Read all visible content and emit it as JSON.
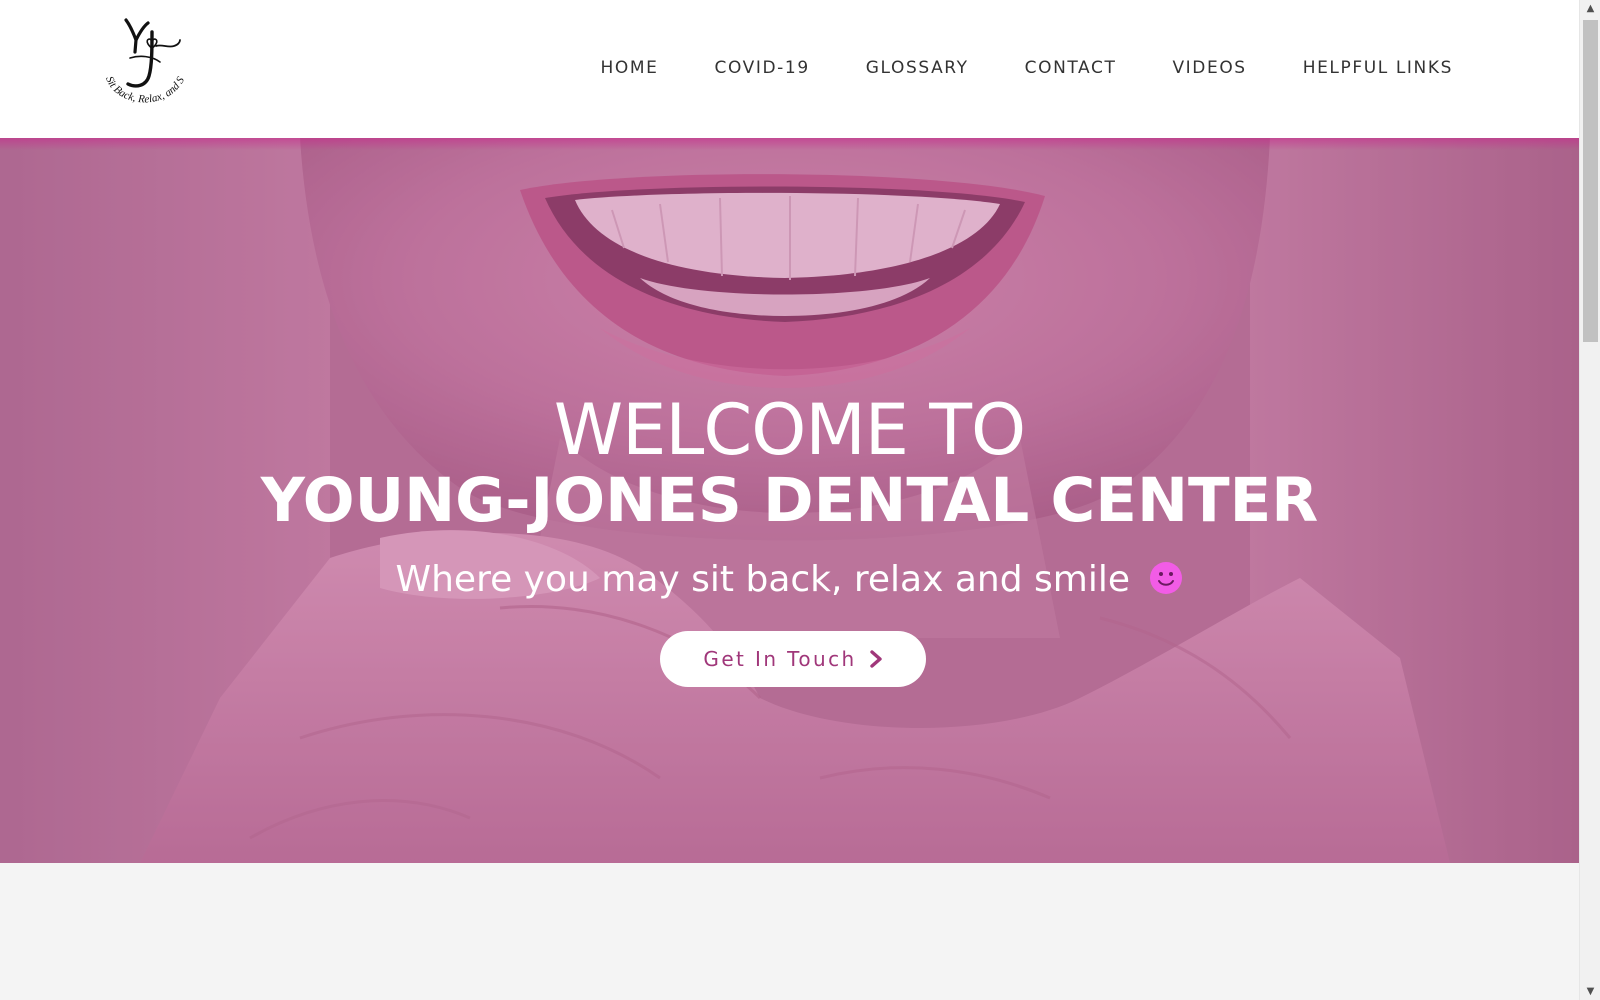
{
  "site": {
    "logo_alt": "YJ logo",
    "logo_tagline": "Sit Back, Relax, and Smile"
  },
  "nav": {
    "items": [
      {
        "label": "HOME"
      },
      {
        "label": "COVID-19"
      },
      {
        "label": "GLOSSARY"
      },
      {
        "label": "CONTACT"
      },
      {
        "label": "VIDEOS"
      },
      {
        "label": "HELPFUL LINKS"
      }
    ]
  },
  "hero": {
    "welcome": "WELCOME TO",
    "clinic_name": "YOUNG-JONES DENTAL CENTER",
    "tagline": "Where you may sit back, relax and smile",
    "cta_label": "Get In Touch"
  },
  "colors": {
    "accent": "#a0377a",
    "hero_tint": "#b57a99",
    "smiley": "#f25ce6"
  },
  "icons": {
    "cta": "chevron-right-icon",
    "smiley": "smiley-face-icon"
  }
}
